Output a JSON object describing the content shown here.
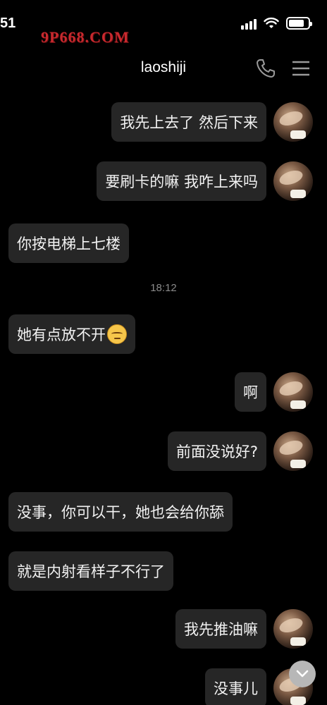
{
  "status_bar": {
    "time": "51",
    "watermark": "9P668.COM"
  },
  "header": {
    "title": "laoshiji",
    "call_icon": "phone-icon",
    "menu_icon": "menu-icon"
  },
  "messages": [
    {
      "side": "right",
      "text": "我先上去了 然后下来"
    },
    {
      "side": "right",
      "text": "要刷卡的嘛 我咋上来吗"
    },
    {
      "side": "left",
      "text": "你按电梯上七楼"
    },
    {
      "side": "left",
      "text": "她有点放不开",
      "emoji": "awkward-face-emoji"
    },
    {
      "side": "right",
      "text": "啊"
    },
    {
      "side": "right",
      "text": "前面没说好?"
    },
    {
      "side": "left",
      "text": "没事，你可以干，她也会给你舔"
    },
    {
      "side": "left",
      "text": "就是内射看样子不行了"
    },
    {
      "side": "right",
      "text": "我先推油嘛"
    },
    {
      "side": "right",
      "text": "没事儿"
    }
  ],
  "timestamp": "18:12",
  "colors": {
    "background": "#000000",
    "bubble": "#262626",
    "watermark": "#c8292e"
  }
}
